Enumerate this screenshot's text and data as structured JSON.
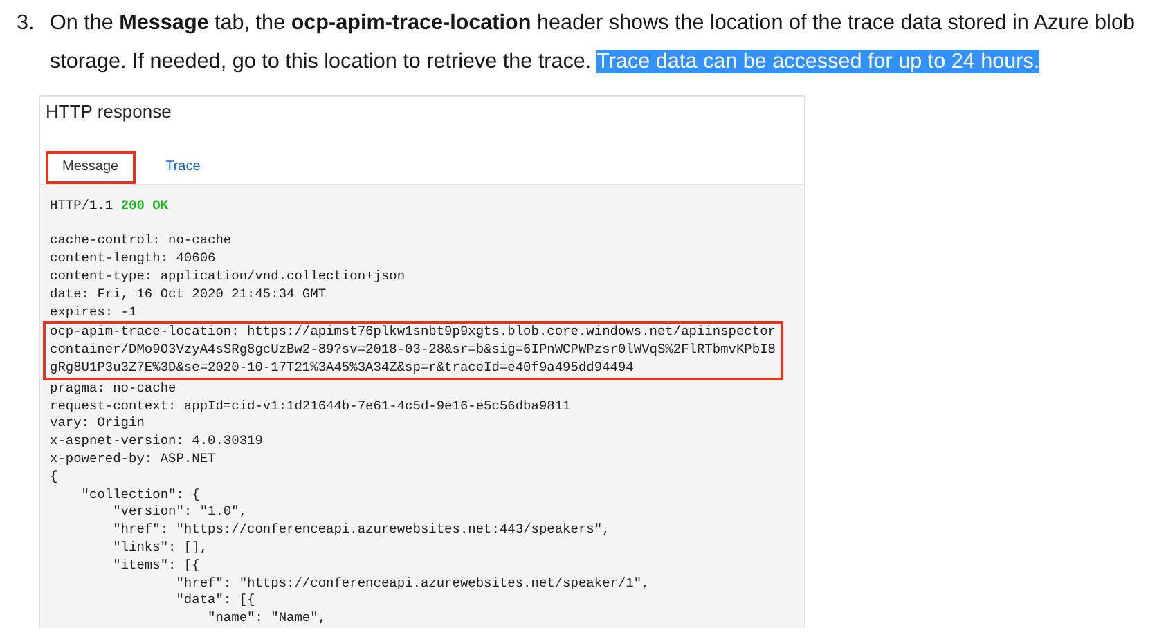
{
  "step": {
    "number": "3.",
    "text": "On the **Message** tab, the **ocp-apim-trace-location** header shows the location of the trace data stored in Azure blob storage. If needed, go to this location to retrieve the trace. ",
    "highlight": "Trace data can be accessed for up to 24 hours."
  },
  "panel": {
    "title": "HTTP response",
    "tabs": [
      {
        "label": "Message",
        "selected": true,
        "outlined": true
      },
      {
        "label": "Trace",
        "selected": false,
        "outlined": false
      }
    ],
    "status_line": {
      "protocol": "HTTP/1.1",
      "status": "200 OK"
    },
    "lines": [
      {
        "text": "cache-control: no-cache",
        "gap_before": true,
        "outlined": false
      },
      {
        "text": "content-length: 40606",
        "gap_before": false,
        "outlined": false
      },
      {
        "text": "content-type: application/vnd.collection+json",
        "gap_before": false,
        "outlined": false
      },
      {
        "text": "date: Fri, 16 Oct 2020 21:45:34 GMT",
        "gap_before": false,
        "outlined": false
      },
      {
        "text": "expires: -1",
        "gap_before": false,
        "outlined": false
      },
      {
        "text": "ocp-apim-trace-location: https://apimst76plkw1snbt9p9xgts.blob.core.windows.net/apiinspector",
        "gap_before": false,
        "outlined": true
      },
      {
        "text": "container/DMo9O3VzyA4sSRg8gcUzBw2-89?sv=2018-03-28&sr=b&sig=6IPnWCPWPzsr0lWVqS%2FlRTbmvKPbI8",
        "gap_before": false,
        "outlined": true
      },
      {
        "text": "gRg8U1P3u3Z7E%3D&se=2020-10-17T21%3A45%3A34Z&sp=r&traceId=e40f9a495dd94494",
        "gap_before": false,
        "outlined": true
      },
      {
        "text": "pragma: no-cache",
        "gap_before": false,
        "outlined": false
      },
      {
        "text": "request-context: appId=cid-v1:1d21644b-7e61-4c5d-9e16-e5c56dba9811",
        "gap_before": false,
        "outlined": false
      },
      {
        "text": "vary: Origin",
        "gap_before": false,
        "outlined": false
      },
      {
        "text": "x-aspnet-version: 4.0.30319",
        "gap_before": false,
        "outlined": false
      },
      {
        "text": "x-powered-by: ASP.NET",
        "gap_before": false,
        "outlined": false
      },
      {
        "text": "{",
        "gap_before": false,
        "outlined": false
      },
      {
        "text": "    \"collection\": {",
        "gap_before": false,
        "outlined": false
      },
      {
        "text": "        \"version\": \"1.0\",",
        "gap_before": false,
        "outlined": false
      },
      {
        "text": "        \"href\": \"https://conferenceapi.azurewebsites.net:443/speakers\",",
        "gap_before": false,
        "outlined": false
      },
      {
        "text": "        \"links\": [],",
        "gap_before": false,
        "outlined": false
      },
      {
        "text": "        \"items\": [{",
        "gap_before": false,
        "outlined": false
      },
      {
        "text": "                \"href\": \"https://conferenceapi.azurewebsites.net/speaker/1\",",
        "gap_before": false,
        "outlined": false
      },
      {
        "text": "                \"data\": [{",
        "gap_before": false,
        "outlined": false
      },
      {
        "text": "                    \"name\": \"Name\",",
        "gap_before": false,
        "outlined": false
      }
    ]
  }
}
